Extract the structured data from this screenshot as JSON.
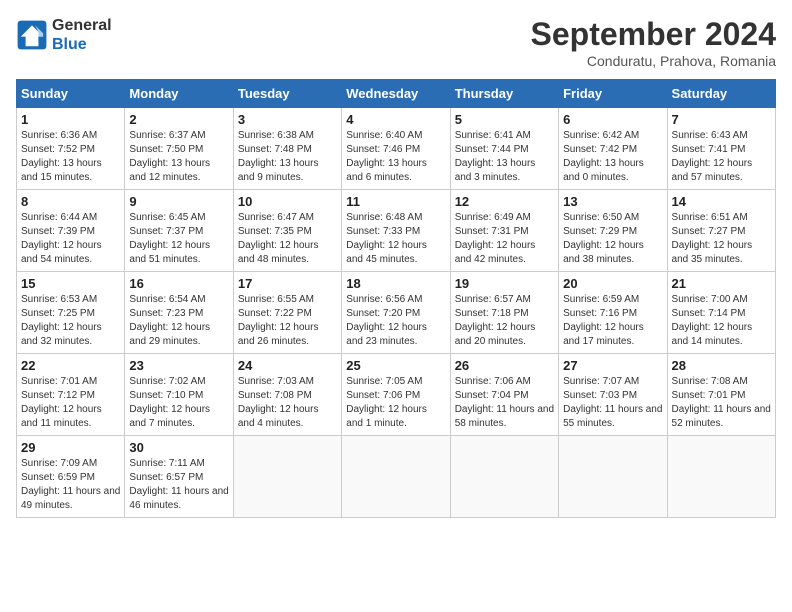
{
  "header": {
    "logo_line1": "General",
    "logo_line2": "Blue",
    "month_year": "September 2024",
    "location": "Conduratu, Prahova, Romania"
  },
  "weekdays": [
    "Sunday",
    "Monday",
    "Tuesday",
    "Wednesday",
    "Thursday",
    "Friday",
    "Saturday"
  ],
  "weeks": [
    [
      {
        "day": "1",
        "sunrise": "Sunrise: 6:36 AM",
        "sunset": "Sunset: 7:52 PM",
        "daylight": "Daylight: 13 hours and 15 minutes."
      },
      {
        "day": "2",
        "sunrise": "Sunrise: 6:37 AM",
        "sunset": "Sunset: 7:50 PM",
        "daylight": "Daylight: 13 hours and 12 minutes."
      },
      {
        "day": "3",
        "sunrise": "Sunrise: 6:38 AM",
        "sunset": "Sunset: 7:48 PM",
        "daylight": "Daylight: 13 hours and 9 minutes."
      },
      {
        "day": "4",
        "sunrise": "Sunrise: 6:40 AM",
        "sunset": "Sunset: 7:46 PM",
        "daylight": "Daylight: 13 hours and 6 minutes."
      },
      {
        "day": "5",
        "sunrise": "Sunrise: 6:41 AM",
        "sunset": "Sunset: 7:44 PM",
        "daylight": "Daylight: 13 hours and 3 minutes."
      },
      {
        "day": "6",
        "sunrise": "Sunrise: 6:42 AM",
        "sunset": "Sunset: 7:42 PM",
        "daylight": "Daylight: 13 hours and 0 minutes."
      },
      {
        "day": "7",
        "sunrise": "Sunrise: 6:43 AM",
        "sunset": "Sunset: 7:41 PM",
        "daylight": "Daylight: 12 hours and 57 minutes."
      }
    ],
    [
      {
        "day": "8",
        "sunrise": "Sunrise: 6:44 AM",
        "sunset": "Sunset: 7:39 PM",
        "daylight": "Daylight: 12 hours and 54 minutes."
      },
      {
        "day": "9",
        "sunrise": "Sunrise: 6:45 AM",
        "sunset": "Sunset: 7:37 PM",
        "daylight": "Daylight: 12 hours and 51 minutes."
      },
      {
        "day": "10",
        "sunrise": "Sunrise: 6:47 AM",
        "sunset": "Sunset: 7:35 PM",
        "daylight": "Daylight: 12 hours and 48 minutes."
      },
      {
        "day": "11",
        "sunrise": "Sunrise: 6:48 AM",
        "sunset": "Sunset: 7:33 PM",
        "daylight": "Daylight: 12 hours and 45 minutes."
      },
      {
        "day": "12",
        "sunrise": "Sunrise: 6:49 AM",
        "sunset": "Sunset: 7:31 PM",
        "daylight": "Daylight: 12 hours and 42 minutes."
      },
      {
        "day": "13",
        "sunrise": "Sunrise: 6:50 AM",
        "sunset": "Sunset: 7:29 PM",
        "daylight": "Daylight: 12 hours and 38 minutes."
      },
      {
        "day": "14",
        "sunrise": "Sunrise: 6:51 AM",
        "sunset": "Sunset: 7:27 PM",
        "daylight": "Daylight: 12 hours and 35 minutes."
      }
    ],
    [
      {
        "day": "15",
        "sunrise": "Sunrise: 6:53 AM",
        "sunset": "Sunset: 7:25 PM",
        "daylight": "Daylight: 12 hours and 32 minutes."
      },
      {
        "day": "16",
        "sunrise": "Sunrise: 6:54 AM",
        "sunset": "Sunset: 7:23 PM",
        "daylight": "Daylight: 12 hours and 29 minutes."
      },
      {
        "day": "17",
        "sunrise": "Sunrise: 6:55 AM",
        "sunset": "Sunset: 7:22 PM",
        "daylight": "Daylight: 12 hours and 26 minutes."
      },
      {
        "day": "18",
        "sunrise": "Sunrise: 6:56 AM",
        "sunset": "Sunset: 7:20 PM",
        "daylight": "Daylight: 12 hours and 23 minutes."
      },
      {
        "day": "19",
        "sunrise": "Sunrise: 6:57 AM",
        "sunset": "Sunset: 7:18 PM",
        "daylight": "Daylight: 12 hours and 20 minutes."
      },
      {
        "day": "20",
        "sunrise": "Sunrise: 6:59 AM",
        "sunset": "Sunset: 7:16 PM",
        "daylight": "Daylight: 12 hours and 17 minutes."
      },
      {
        "day": "21",
        "sunrise": "Sunrise: 7:00 AM",
        "sunset": "Sunset: 7:14 PM",
        "daylight": "Daylight: 12 hours and 14 minutes."
      }
    ],
    [
      {
        "day": "22",
        "sunrise": "Sunrise: 7:01 AM",
        "sunset": "Sunset: 7:12 PM",
        "daylight": "Daylight: 12 hours and 11 minutes."
      },
      {
        "day": "23",
        "sunrise": "Sunrise: 7:02 AM",
        "sunset": "Sunset: 7:10 PM",
        "daylight": "Daylight: 12 hours and 7 minutes."
      },
      {
        "day": "24",
        "sunrise": "Sunrise: 7:03 AM",
        "sunset": "Sunset: 7:08 PM",
        "daylight": "Daylight: 12 hours and 4 minutes."
      },
      {
        "day": "25",
        "sunrise": "Sunrise: 7:05 AM",
        "sunset": "Sunset: 7:06 PM",
        "daylight": "Daylight: 12 hours and 1 minute."
      },
      {
        "day": "26",
        "sunrise": "Sunrise: 7:06 AM",
        "sunset": "Sunset: 7:04 PM",
        "daylight": "Daylight: 11 hours and 58 minutes."
      },
      {
        "day": "27",
        "sunrise": "Sunrise: 7:07 AM",
        "sunset": "Sunset: 7:03 PM",
        "daylight": "Daylight: 11 hours and 55 minutes."
      },
      {
        "day": "28",
        "sunrise": "Sunrise: 7:08 AM",
        "sunset": "Sunset: 7:01 PM",
        "daylight": "Daylight: 11 hours and 52 minutes."
      }
    ],
    [
      {
        "day": "29",
        "sunrise": "Sunrise: 7:09 AM",
        "sunset": "Sunset: 6:59 PM",
        "daylight": "Daylight: 11 hours and 49 minutes."
      },
      {
        "day": "30",
        "sunrise": "Sunrise: 7:11 AM",
        "sunset": "Sunset: 6:57 PM",
        "daylight": "Daylight: 11 hours and 46 minutes."
      },
      null,
      null,
      null,
      null,
      null
    ]
  ]
}
